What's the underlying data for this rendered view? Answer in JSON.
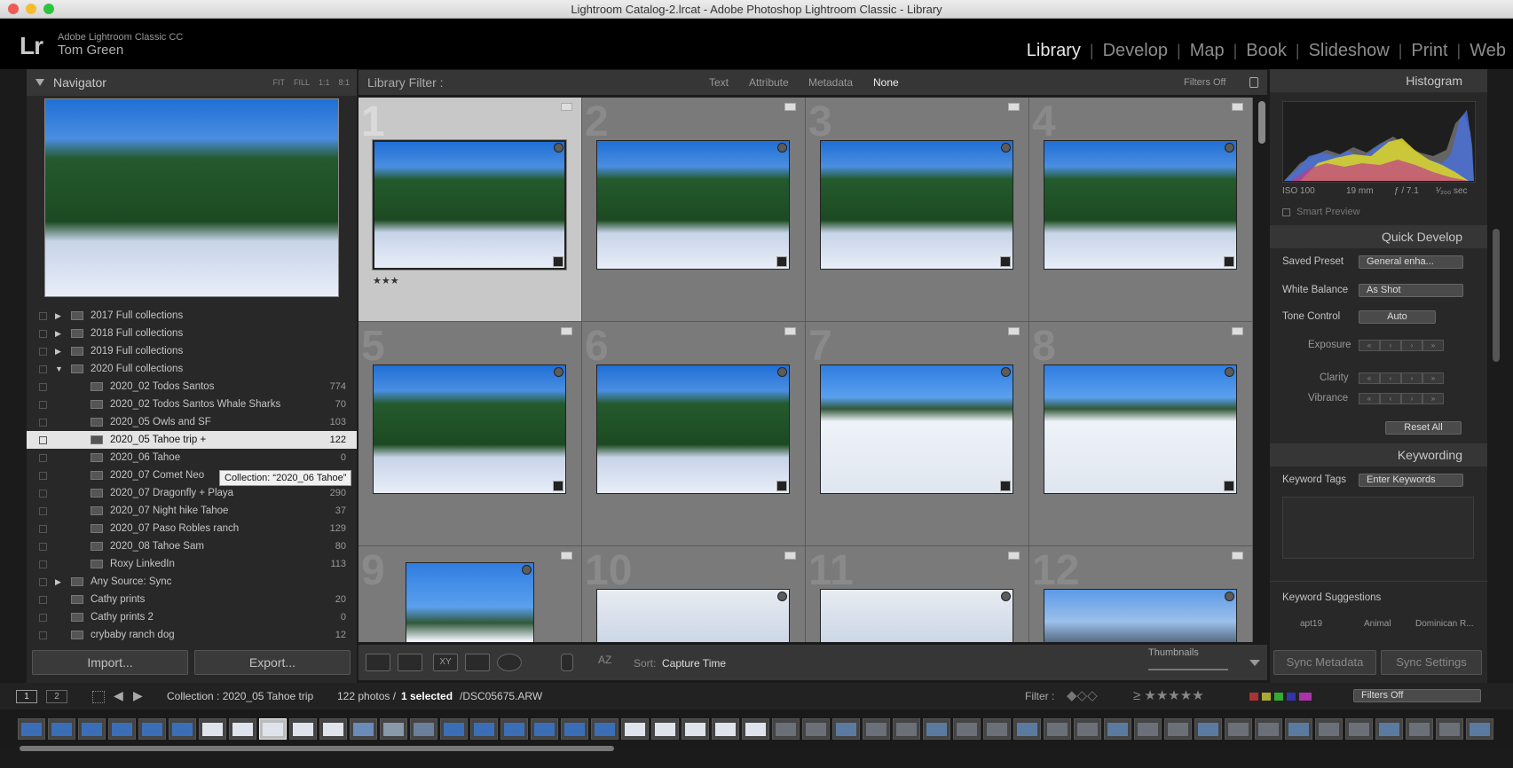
{
  "window": {
    "title": "Lightroom Catalog-2.lrcat - Adobe Photoshop Lightroom Classic - Library"
  },
  "identity": {
    "logo": "Lr",
    "app": "Adobe Lightroom Classic CC",
    "user": "Tom Green"
  },
  "modules": [
    "Library",
    "Develop",
    "Map",
    "Book",
    "Slideshow",
    "Print",
    "Web"
  ],
  "navigator": {
    "title": "Navigator",
    "options": [
      "FIT",
      "FILL",
      "1:1",
      "8:1"
    ]
  },
  "collections": [
    {
      "name": "2017 Full collections",
      "count": "",
      "level": 1,
      "expanded": false
    },
    {
      "name": "2018 Full collections",
      "count": "",
      "level": 1,
      "expanded": false
    },
    {
      "name": "2019 Full collections",
      "count": "",
      "level": 1,
      "expanded": false
    },
    {
      "name": "2020 Full collections",
      "count": "",
      "level": 1,
      "expanded": true
    },
    {
      "name": "2020_02 Todos Santos",
      "count": "774",
      "level": 2
    },
    {
      "name": "2020_02 Todos Santos Whale Sharks",
      "count": "70",
      "level": 2
    },
    {
      "name": "2020_05 Owls and SF",
      "count": "103",
      "level": 2
    },
    {
      "name": "2020_05 Tahoe trip  +",
      "count": "122",
      "level": 2,
      "selected": true
    },
    {
      "name": "2020_06 Tahoe",
      "count": "0",
      "level": 2
    },
    {
      "name": "2020_07 Comet Neo",
      "count": "",
      "level": 2
    },
    {
      "name": "2020_07 Dragonfly + Playa",
      "count": "290",
      "level": 2
    },
    {
      "name": "2020_07 Night hike Tahoe",
      "count": "37",
      "level": 2
    },
    {
      "name": "2020_07 Paso Robles ranch",
      "count": "129",
      "level": 2
    },
    {
      "name": "2020_08 Tahoe Sam",
      "count": "80",
      "level": 2
    },
    {
      "name": "Roxy LinkedIn",
      "count": "113",
      "level": 2
    },
    {
      "name": "Any Source: Sync",
      "count": "",
      "level": 1,
      "expanded": false
    },
    {
      "name": "Cathy prints",
      "count": "20",
      "level": 1
    },
    {
      "name": "Cathy prints 2",
      "count": "0",
      "level": 1
    },
    {
      "name": "crybaby ranch dog",
      "count": "12",
      "level": 1
    }
  ],
  "tooltip": "Collection: “2020_06 Tahoe”",
  "left_buttons": {
    "import": "Import...",
    "export": "Export..."
  },
  "filterbar": {
    "label": "Library Filter :",
    "options": [
      "Text",
      "Attribute",
      "Metadata",
      "None"
    ],
    "active": "None",
    "filters_off": "Filters Off"
  },
  "grid": {
    "cells": [
      {
        "num": "1",
        "photo": "forest",
        "rating": "★★★",
        "selected": true
      },
      {
        "num": "2",
        "photo": "forest"
      },
      {
        "num": "3",
        "photo": "forest"
      },
      {
        "num": "4",
        "photo": "forest"
      },
      {
        "num": "5",
        "photo": "forest"
      },
      {
        "num": "6",
        "photo": "forest"
      },
      {
        "num": "7",
        "photo": "snow"
      },
      {
        "num": "8",
        "photo": "snow"
      },
      {
        "num": "9",
        "photo": "snow"
      },
      {
        "num": "10",
        "photo": "snow2"
      },
      {
        "num": "11",
        "photo": "snow2"
      },
      {
        "num": "12",
        "photo": "mtn"
      }
    ]
  },
  "toolbar": {
    "sort_label": "Sort:",
    "sort_value": "Capture Time",
    "thumbnails_label": "Thumbnails"
  },
  "histogram": {
    "title": "Histogram",
    "iso": "ISO 100",
    "focal": "19 mm",
    "aperture": "ƒ / 7.1",
    "shutter": "¹⁄₂₀₀ sec",
    "smart_preview": "Smart Preview"
  },
  "quick_develop": {
    "title": "Quick Develop",
    "saved_preset_label": "Saved Preset",
    "saved_preset": "General enha...",
    "wb_label": "White Balance",
    "wb": "As Shot",
    "tone_label": "Tone Control",
    "auto": "Auto",
    "exposure": "Exposure",
    "clarity": "Clarity",
    "vibrance": "Vibrance",
    "reset": "Reset All"
  },
  "keywording": {
    "title": "Keywording",
    "tags_label": "Keyword Tags",
    "tags_value": "Enter Keywords",
    "suggestions_label": "Keyword Suggestions",
    "suggestions": [
      "apt19",
      "Animal",
      "Dominican R..."
    ]
  },
  "sync": {
    "metadata": "Sync Metadata",
    "settings": "Sync Settings"
  },
  "filmstrip": {
    "pages": [
      "1",
      "2"
    ],
    "collection": "Collection : 2020_05 Tahoe trip",
    "photos": "122 photos /",
    "selected": "1 selected",
    "file": "/DSC05675.ARW",
    "filter_label": "Filter :",
    "filters_off": "Filters Off"
  },
  "colors": {
    "accent": "#e8e8e8",
    "panel": "#282828",
    "grid": "#6e6e6e"
  }
}
